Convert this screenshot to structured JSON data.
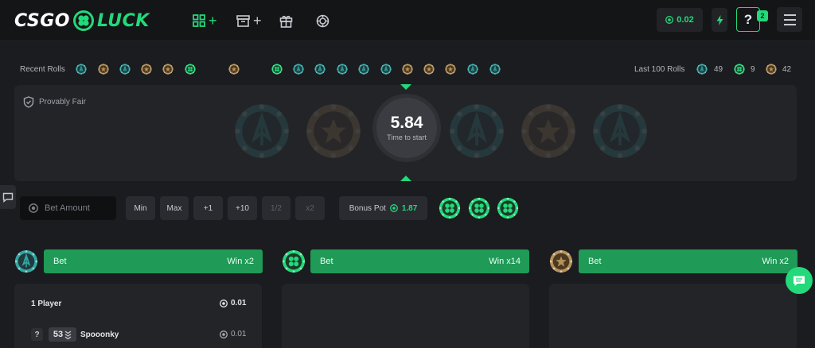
{
  "header": {
    "logo_left": "CSGO",
    "logo_right": "LUCK",
    "nav": [
      {
        "icon": "grid-plus-icon",
        "label": "+"
      },
      {
        "icon": "archive-plus-icon",
        "label": "+"
      },
      {
        "icon": "gift-icon",
        "label": ""
      },
      {
        "icon": "chip-icon",
        "label": ""
      }
    ],
    "balance": "0.02",
    "help_label": "?",
    "help_badge": "2"
  },
  "recent": {
    "label": "Recent Rolls",
    "rolls": [
      "ct",
      "t",
      "ct",
      "t",
      "t",
      "bonus",
      "t",
      "bonus",
      "ct",
      "ct",
      "ct",
      "ct",
      "ct",
      "t",
      "t",
      "t",
      "ct",
      "ct"
    ],
    "last100_label": "Last 100 Rolls",
    "stats": [
      {
        "type": "ct",
        "count": "49"
      },
      {
        "type": "bonus",
        "count": "9"
      },
      {
        "type": "t",
        "count": "42"
      }
    ]
  },
  "spinner": {
    "provably_fair": "Provably Fair",
    "countdown": "5.84",
    "countdown_label": "Time to start"
  },
  "controls": {
    "bet_placeholder": "Bet Amount",
    "buttons": [
      "Min",
      "Max",
      "+1",
      "+10",
      "1/2",
      "x2"
    ],
    "bonus_label": "Bonus Pot",
    "bonus_value": "1.87"
  },
  "columns": [
    {
      "type": "ct",
      "bet_label": "Bet",
      "win_label": "Win x2"
    },
    {
      "type": "bonus",
      "bet_label": "Bet",
      "win_label": "Win x14"
    },
    {
      "type": "t",
      "bet_label": "Bet",
      "win_label": "Win x2"
    }
  ],
  "bets": {
    "players_label": "1 Player",
    "total": "0.01",
    "row": {
      "badge": "?",
      "level": "53",
      "name": "Spooonky",
      "amount": "0.01"
    }
  },
  "colors": {
    "accent": "#23d97a",
    "bet_bar": "#1f9a57",
    "ct": "#33a7a4",
    "t": "#b6925a"
  }
}
